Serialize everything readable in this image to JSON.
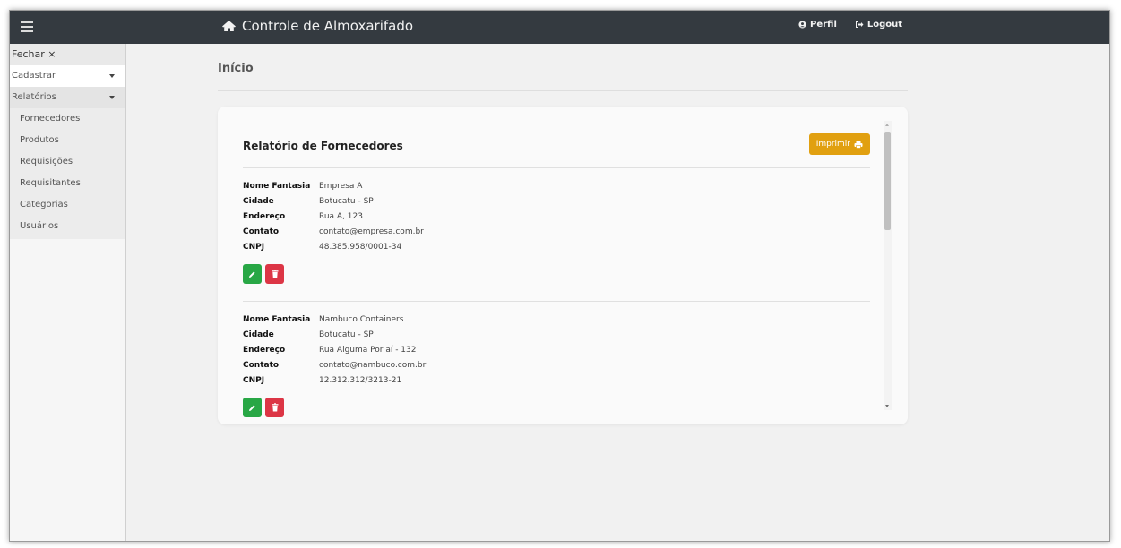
{
  "app": {
    "title": "Controle de Almoxarifado"
  },
  "topnav": {
    "profile_label": "Perfil",
    "logout_label": "Logout"
  },
  "sidebar": {
    "close_label": "Fechar ×",
    "menus": [
      {
        "label": "Cadastrar"
      },
      {
        "label": "Relatórios"
      }
    ],
    "report_items": [
      {
        "label": "Fornecedores"
      },
      {
        "label": "Produtos"
      },
      {
        "label": "Requisições"
      },
      {
        "label": "Requisitantes"
      },
      {
        "label": "Categorias"
      },
      {
        "label": "Usuários"
      }
    ]
  },
  "main": {
    "page_title": "Início",
    "report_title": "Relatório de Fornecedores",
    "print_label": "Imprimir",
    "field_labels": {
      "nome": "Nome Fantasia",
      "cidade": "Cidade",
      "endereco": "Endereço",
      "contato": "Contato",
      "cnpj": "CNPJ"
    },
    "records": [
      {
        "nome": "Empresa A",
        "cidade": "Botucatu - SP",
        "endereco": "Rua A, 123",
        "contato": "contato@empresa.com.br",
        "cnpj": "48.385.958/0001-34"
      },
      {
        "nome": "Nambuco Containers",
        "cidade": "Botucatu - SP",
        "endereco": "Rua Alguma Por aí - 132",
        "contato": "contato@nambuco.com.br",
        "cnpj": "12.312.312/3213-21"
      }
    ]
  },
  "colors": {
    "topbar": "#343a40",
    "print_button": "#e1a010",
    "edit_button": "#28a745",
    "delete_button": "#dc3545"
  },
  "icons": {
    "menu": "hamburger-icon",
    "brand": "home-icon",
    "profile": "user-circle-icon",
    "logout": "logout-icon",
    "print": "printer-icon",
    "edit": "pencil-icon",
    "delete": "trash-icon"
  }
}
